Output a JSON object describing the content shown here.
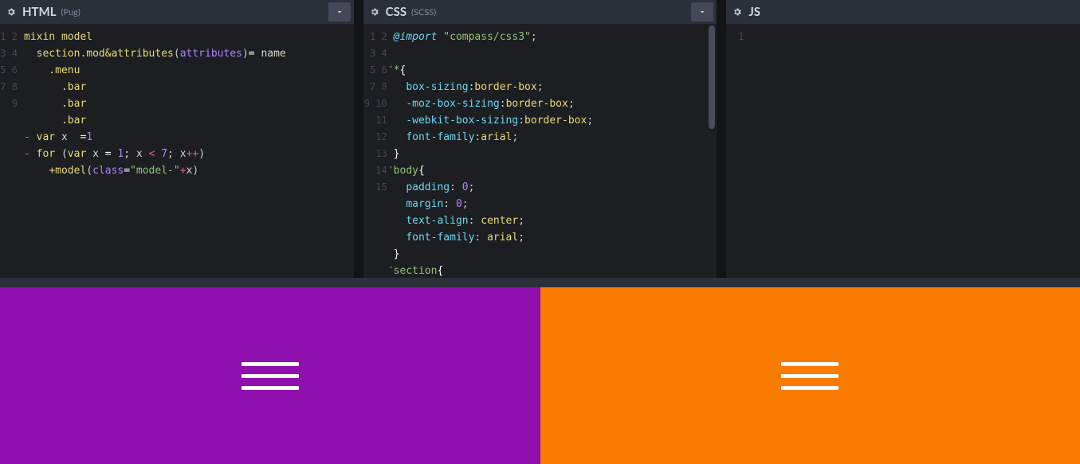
{
  "panes": {
    "html": {
      "title": "HTML",
      "sub": "(Pug)"
    },
    "css": {
      "title": "CSS",
      "sub": "(SCSS)"
    },
    "js": {
      "title": "JS",
      "sub": ""
    }
  },
  "html_lines": [
    "1",
    "2",
    "3",
    "4",
    "5",
    "6",
    "7",
    "8",
    "9"
  ],
  "html_code": {
    "l1_kw": "mixin",
    "l1_name": " model",
    "l2_indent": "  ",
    "l2_a": "section",
    "l2_b": ".mod",
    "l2_c": "&attributes",
    "l2_paren_o": "(",
    "l2_d": "attributes",
    "l2_paren_c": ")",
    "l2_eq": "= ",
    "l2_e": "name",
    "l3": "    .menu",
    "l4": "      .bar",
    "l5": "      .bar",
    "l6": "      .bar",
    "l7_dash": "- ",
    "l7_a": "var",
    "l7_b": " x  ",
    "l7_eq": "=",
    "l7_c": "1",
    "l8_dash": "- ",
    "l8_a": "for",
    "l8_b": " (",
    "l8_c": "var",
    "l8_d": " x ",
    "l8_e": "= ",
    "l8_f": "1",
    "l8_g": "; x ",
    "l8_h": "< ",
    "l8_i": "7",
    "l8_j": "; x",
    "l8_k": "++",
    "l8_l": ")",
    "l9_indent": "    ",
    "l9_a": "+model",
    "l9_paren_o": "(",
    "l9_b": "class",
    "l9_eq": "=",
    "l9_c": "\"model-\"",
    "l9_plus": "+",
    "l9_d": "x",
    "l9_paren_c": ")"
  },
  "css_lines": [
    "1",
    "2",
    "3",
    "4",
    "5",
    "6",
    "7",
    "8",
    "9",
    "10",
    "11",
    "12",
    "13",
    "14",
    "15"
  ],
  "css_code": {
    "l1_a": "@import",
    "l1_b": " \"compass/css3\"",
    "l1_c": ";",
    "l2": "",
    "l3_a": "*",
    "l3_b": "{",
    "l4_a": "  box-sizing",
    "l4_b": ":",
    "l4_c": "border-box",
    "l4_d": ";",
    "l5_a": "  -moz-box-sizing",
    "l5_b": ":",
    "l5_c": "border-box",
    "l5_d": ";",
    "l6_a": "  -webkit-box-sizing",
    "l6_b": ":",
    "l6_c": "border-box",
    "l6_d": ";",
    "l7_a": "  font-family",
    "l7_b": ":",
    "l7_c": "arial",
    "l7_d": ";",
    "l8": "}",
    "l9_a": "body",
    "l9_b": "{",
    "l10_a": "  padding",
    "l10_b": ": ",
    "l10_c": "0",
    "l10_d": ";",
    "l11_a": "  margin",
    "l11_b": ": ",
    "l11_c": "0",
    "l11_d": ";",
    "l12_a": "  text-align",
    "l12_b": ": ",
    "l12_c": "center",
    "l12_d": ";",
    "l13_a": "  font-family",
    "l13_b": ": ",
    "l13_c": "arial",
    "l13_d": ";",
    "l14": "}",
    "l15_a": "section",
    "l15_b": "{"
  },
  "js_lines": [
    "1"
  ],
  "preview": {
    "colors": [
      "#8e0fad",
      "#f97b00"
    ]
  }
}
